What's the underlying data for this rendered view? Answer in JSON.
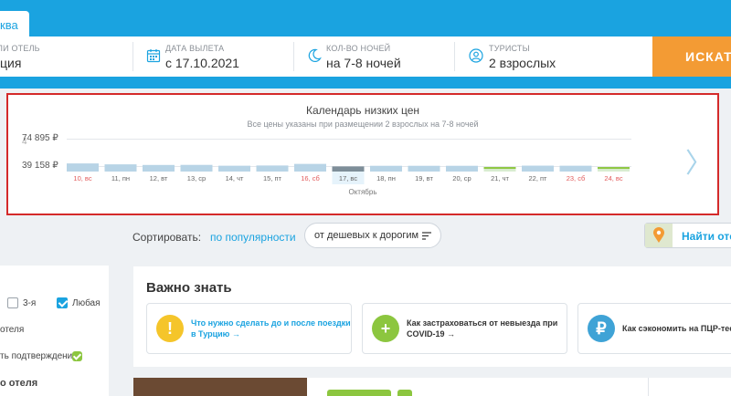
{
  "header": {
    "active_tab_fragment": "ква",
    "fields": [
      {
        "label": "ЛИ ОТЕЛЬ",
        "value": "ция"
      },
      {
        "label": "ДАТА ВЫЛЕТА",
        "value": "с 17.10.2021"
      },
      {
        "label": "КОЛ-ВО НОЧЕЙ",
        "value": "на 7-8 ночей"
      },
      {
        "label": "ТУРИСТЫ",
        "value": "2 взрослых"
      }
    ],
    "search_button": "ИСКАТЬ"
  },
  "calendar": {
    "title": "Календарь низких цен",
    "subtitle": "Все цены указаны при размещении 2 взрослых на 7-8 ночей",
    "prev_fragment": "4",
    "y_max_label": "74 895 ₽",
    "y_min_label": "39 158 ₽",
    "month": "Октябрь",
    "next_arrow": "〉"
  },
  "chart_data": {
    "type": "bar",
    "categories": [
      "10, вс",
      "11, пн",
      "12, вт",
      "13, ср",
      "14, чт",
      "15, пт",
      "16, сб",
      "17, вс",
      "18, пн",
      "19, вт",
      "20, ср",
      "21, чт",
      "22, пт",
      "23, сб",
      "24, вс"
    ],
    "weekend": [
      true,
      false,
      false,
      false,
      false,
      false,
      true,
      true,
      false,
      false,
      false,
      false,
      false,
      true,
      true
    ],
    "selected_index": 7,
    "values": [
      42600,
      41400,
      40600,
      40700,
      39600,
      39900,
      42000,
      38700,
      39500,
      39500,
      39500,
      37900,
      39700,
      39600,
      37900
    ],
    "ylim": [
      32000,
      74895
    ],
    "yticks": [
      39158,
      74895
    ],
    "colors": {
      "bar": "#b8d4e6",
      "bar_selected": "#7e8e99",
      "bar_min": "#d8ecd0",
      "min_marker": "#8cc63f",
      "weekend_label": "#e25b5b",
      "weekday_label": "#666666",
      "selected_label_bg": "#e6f3fb"
    }
  },
  "sort": {
    "label": "Сортировать:",
    "popular": "по популярности",
    "cheap": "от дешевых к дорогим"
  },
  "map": {
    "label": "Найти отел"
  },
  "filters": {
    "stars_3": "3-я",
    "any": "Любая",
    "hotel_fragment": "отеля",
    "confirm_fragment": "ть подтверждения",
    "hotel_bold_fragment": "о отеля"
  },
  "important": {
    "title": "Важно знать",
    "cards": [
      {
        "text": "Что нужно сделать до и после поездки в Турцию →",
        "icon": "!",
        "color": "#f5c52a"
      },
      {
        "text": "Как застраховаться от невыезда при COVID-19 →",
        "icon": "+",
        "color": "#8cc63f"
      },
      {
        "text": "Как сэкономить на ПЦР-тес",
        "icon": "₽",
        "color": "#3fa3d6"
      }
    ]
  }
}
